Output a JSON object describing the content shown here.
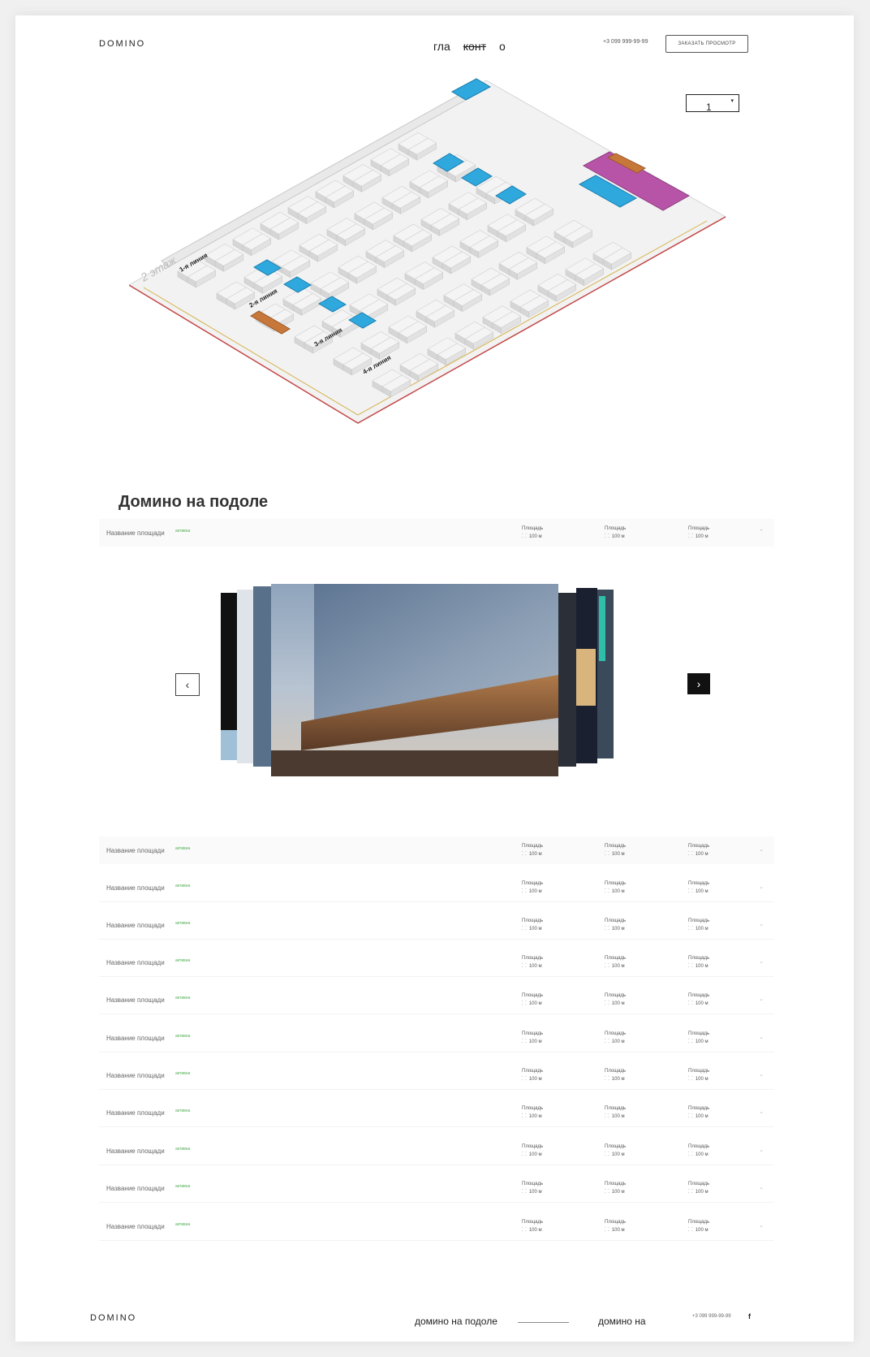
{
  "header": {
    "logo": "DOMINO",
    "nav": [
      "гла",
      "конт",
      "о"
    ],
    "phone": "+3 099 999-99-99",
    "cta_label": "ЗАКАЗАТЬ ПРОСМОТР",
    "floor_value": "1"
  },
  "map": {
    "floor_label": "2 этаж",
    "lines": [
      "1-я линия",
      "2-я линия",
      "3-я линия",
      "4-я линия"
    ],
    "colors": {
      "stall": "#e4e4e4",
      "blue": "#2fa8de",
      "orange": "#c8773a",
      "magenta": "#b854a8",
      "border_red": "#c44848",
      "border_yellow": "#d4b24a"
    }
  },
  "section_title": "Домино на подоле",
  "row_template": {
    "name": "Название площади",
    "status": "активна",
    "stat_label": "Площадь",
    "stat_value": "100 м"
  },
  "gallery": {
    "prev_icon": "chevron-left-icon",
    "next_icon": "chevron-right-icon"
  },
  "footer": {
    "logo": "DOMINO",
    "link1": "домино на подоле",
    "link2": "домино на",
    "phone": "+3 099 999-99-99",
    "social": "f"
  }
}
